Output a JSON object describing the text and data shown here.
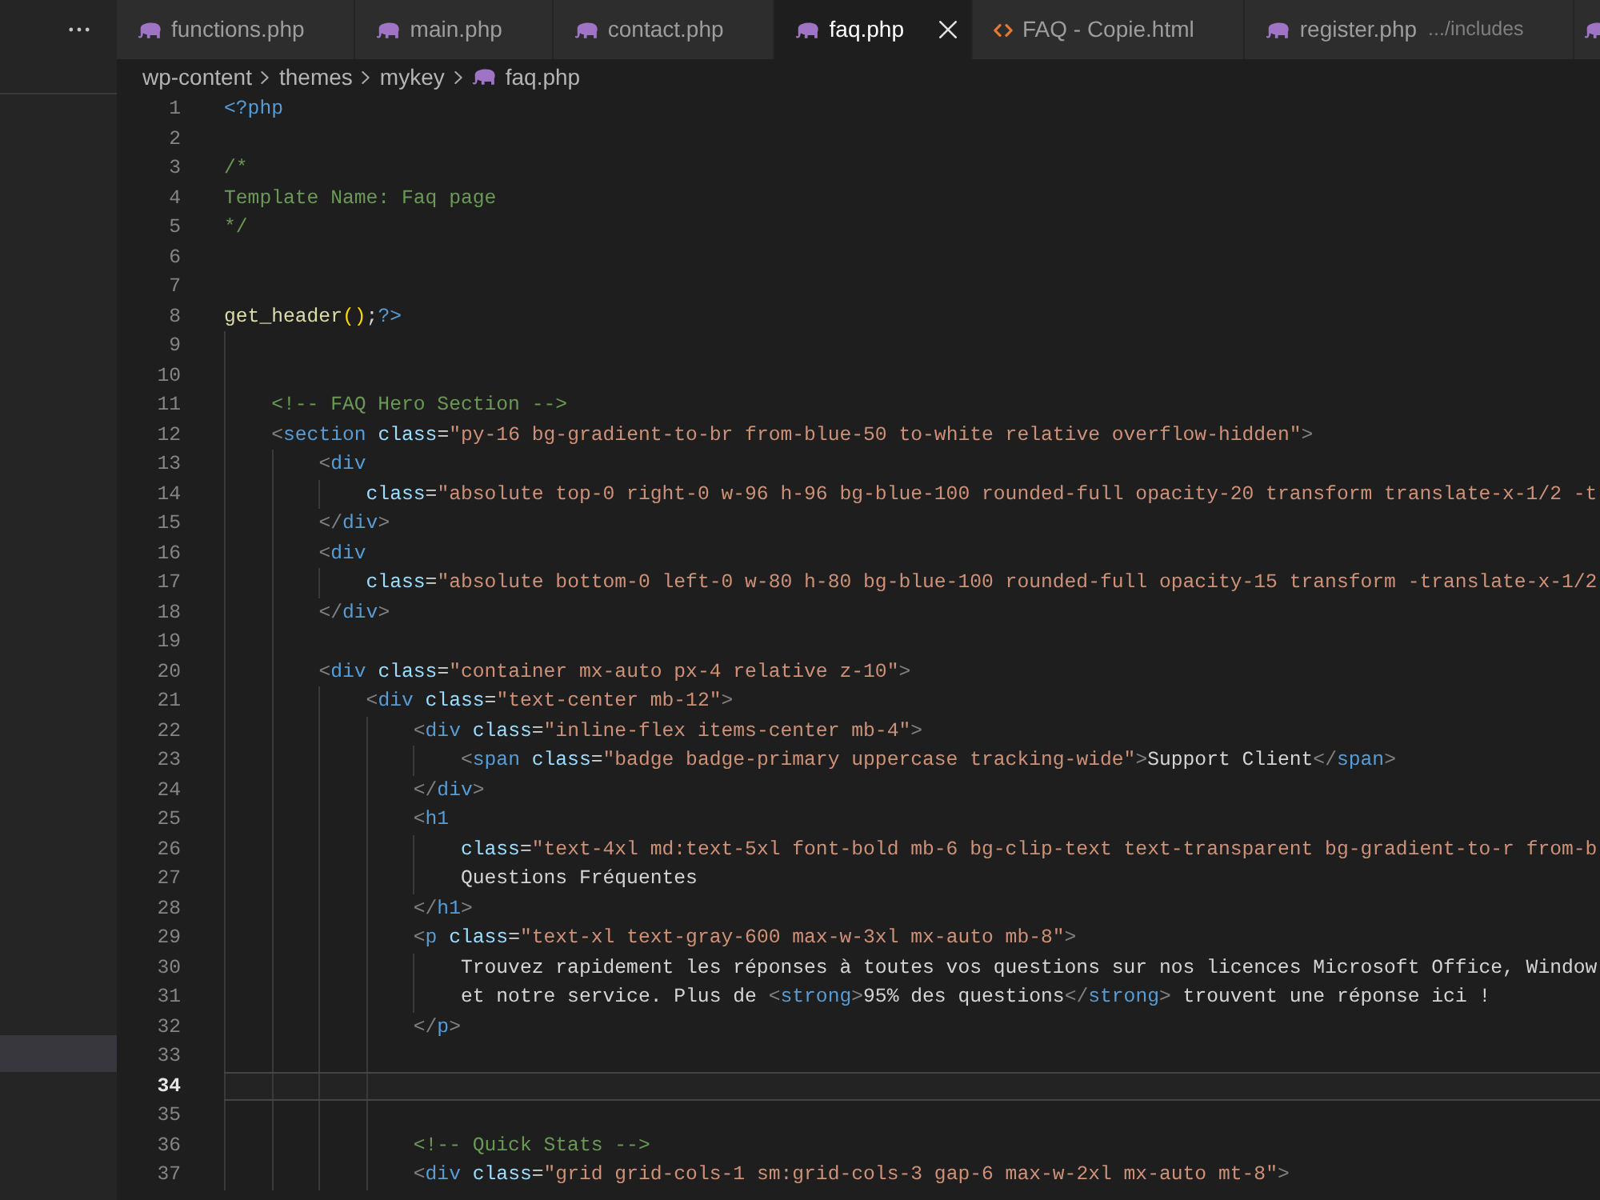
{
  "sidebar": {
    "rows": [
      {
        "selected": true
      }
    ]
  },
  "tabs": [
    {
      "kind": "php",
      "label": "functions.php",
      "selected": false
    },
    {
      "kind": "php",
      "label": "main.php",
      "selected": false
    },
    {
      "kind": "php",
      "label": "contact.php",
      "selected": false
    },
    {
      "kind": "php",
      "label": "faq.php",
      "selected": true
    },
    {
      "kind": "html",
      "label": "FAQ - Copie.html",
      "selected": false
    },
    {
      "kind": "php",
      "label": "register.php",
      "description": ".../includes",
      "selected": false
    },
    {
      "kind": "php",
      "selected": false
    }
  ],
  "breadcrumb": [
    {
      "label": "wp-content"
    },
    {
      "label": "themes"
    },
    {
      "label": "mykey"
    },
    {
      "kind": "php",
      "label": "faq.php"
    }
  ],
  "editor": {
    "lines": [
      {
        "number": "1",
        "current": false,
        "tokens": [
          {
            "kind": "keyword",
            "text": "<?php"
          }
        ]
      },
      {
        "number": "2",
        "current": false
      },
      {
        "number": "3",
        "current": false,
        "tokens": [
          {
            "kind": "comment",
            "text": "/*"
          }
        ]
      },
      {
        "number": "4",
        "current": false,
        "tokens": [
          {
            "kind": "comment",
            "text": "Template Name: Faq page"
          }
        ]
      },
      {
        "number": "5",
        "current": false,
        "tokens": [
          {
            "kind": "comment",
            "text": "*/"
          }
        ]
      },
      {
        "number": "6",
        "current": false
      },
      {
        "number": "7",
        "current": false
      },
      {
        "number": "8",
        "current": false,
        "tokens": [
          {
            "kind": "func",
            "text": "get_header"
          },
          {
            "kind": "bracket",
            "text": "()"
          },
          {
            "kind": "text",
            "text": ";"
          },
          {
            "kind": "keyword",
            "text": "?>"
          }
        ],
        "children": [
          {
            "number": "9",
            "current": false
          },
          {
            "number": "10",
            "current": false
          },
          {
            "number": "11",
            "current": false,
            "tokens": [
              {
                "kind": "comment",
                "text": "<!-- FAQ Hero Section -->"
              }
            ]
          },
          {
            "number": "12",
            "current": false,
            "tokens": [
              {
                "kind": "punct",
                "text": "<"
              },
              {
                "kind": "tag",
                "text": "section"
              },
              {
                "kind": "attr",
                "text": " class"
              },
              {
                "kind": "op",
                "text": "="
              },
              {
                "kind": "string",
                "text": "\"py-16 bg-gradient-to-br from-blue-50 to-white relative overflow-hidden\""
              },
              {
                "kind": "punct",
                "text": ">"
              }
            ],
            "children": [
              {
                "number": "13",
                "current": false,
                "tokens": [
                  {
                    "kind": "punct",
                    "text": "<"
                  },
                  {
                    "kind": "tag",
                    "text": "div"
                  }
                ],
                "children": [
                  {
                    "number": "14",
                    "current": false,
                    "tokens": [
                      {
                        "kind": "attr",
                        "text": "class"
                      },
                      {
                        "kind": "op",
                        "text": "="
                      },
                      {
                        "kind": "string",
                        "text": "\"absolute top-0 right-0 w-96 h-96 bg-blue-100 rounded-full opacity-20 transform translate-x-1/2 -t"
                      }
                    ]
                  }
                ]
              },
              {
                "number": "15",
                "current": false,
                "tokens": [
                  {
                    "kind": "punct",
                    "text": "</"
                  },
                  {
                    "kind": "tag",
                    "text": "div"
                  },
                  {
                    "kind": "punct",
                    "text": ">"
                  }
                ]
              },
              {
                "number": "16",
                "current": false,
                "tokens": [
                  {
                    "kind": "punct",
                    "text": "<"
                  },
                  {
                    "kind": "tag",
                    "text": "div"
                  }
                ],
                "children": [
                  {
                    "number": "17",
                    "current": false,
                    "tokens": [
                      {
                        "kind": "attr",
                        "text": "class"
                      },
                      {
                        "kind": "op",
                        "text": "="
                      },
                      {
                        "kind": "string",
                        "text": "\"absolute bottom-0 left-0 w-80 h-80 bg-blue-100 rounded-full opacity-15 transform -translate-x-1/2"
                      }
                    ]
                  }
                ]
              },
              {
                "number": "18",
                "current": false,
                "tokens": [
                  {
                    "kind": "punct",
                    "text": "</"
                  },
                  {
                    "kind": "tag",
                    "text": "div"
                  },
                  {
                    "kind": "punct",
                    "text": ">"
                  }
                ]
              },
              {
                "number": "19",
                "current": false
              },
              {
                "number": "20",
                "current": false,
                "tokens": [
                  {
                    "kind": "punct",
                    "text": "<"
                  },
                  {
                    "kind": "tag",
                    "text": "div"
                  },
                  {
                    "kind": "attr",
                    "text": " class"
                  },
                  {
                    "kind": "op",
                    "text": "="
                  },
                  {
                    "kind": "string",
                    "text": "\"container mx-auto px-4 relative z-10\""
                  },
                  {
                    "kind": "punct",
                    "text": ">"
                  }
                ],
                "children": [
                  {
                    "number": "21",
                    "current": false,
                    "tokens": [
                      {
                        "kind": "punct",
                        "text": "<"
                      },
                      {
                        "kind": "tag",
                        "text": "div"
                      },
                      {
                        "kind": "attr",
                        "text": " class"
                      },
                      {
                        "kind": "op",
                        "text": "="
                      },
                      {
                        "kind": "string",
                        "text": "\"text-center mb-12\""
                      },
                      {
                        "kind": "punct",
                        "text": ">"
                      }
                    ],
                    "children": [
                      {
                        "number": "22",
                        "current": false,
                        "tokens": [
                          {
                            "kind": "punct",
                            "text": "<"
                          },
                          {
                            "kind": "tag",
                            "text": "div"
                          },
                          {
                            "kind": "attr",
                            "text": " class"
                          },
                          {
                            "kind": "op",
                            "text": "="
                          },
                          {
                            "kind": "string",
                            "text": "\"inline-flex items-center mb-4\""
                          },
                          {
                            "kind": "punct",
                            "text": ">"
                          }
                        ],
                        "children": [
                          {
                            "number": "23",
                            "current": false,
                            "tokens": [
                              {
                                "kind": "punct",
                                "text": "<"
                              },
                              {
                                "kind": "tag",
                                "text": "span"
                              },
                              {
                                "kind": "attr",
                                "text": " class"
                              },
                              {
                                "kind": "op",
                                "text": "="
                              },
                              {
                                "kind": "string",
                                "text": "\"badge badge-primary uppercase tracking-wide\""
                              },
                              {
                                "kind": "punct",
                                "text": ">"
                              },
                              {
                                "kind": "text",
                                "text": "Support Client"
                              },
                              {
                                "kind": "punct",
                                "text": "</"
                              },
                              {
                                "kind": "tag",
                                "text": "span"
                              },
                              {
                                "kind": "punct",
                                "text": ">"
                              }
                            ]
                          }
                        ]
                      },
                      {
                        "number": "24",
                        "current": false,
                        "tokens": [
                          {
                            "kind": "punct",
                            "text": "</"
                          },
                          {
                            "kind": "tag",
                            "text": "div"
                          },
                          {
                            "kind": "punct",
                            "text": ">"
                          }
                        ]
                      },
                      {
                        "number": "25",
                        "current": false,
                        "tokens": [
                          {
                            "kind": "punct",
                            "text": "<"
                          },
                          {
                            "kind": "tag",
                            "text": "h1"
                          }
                        ],
                        "children": [
                          {
                            "number": "26",
                            "current": false,
                            "tokens": [
                              {
                                "kind": "attr",
                                "text": "class"
                              },
                              {
                                "kind": "op",
                                "text": "="
                              },
                              {
                                "kind": "string",
                                "text": "\"text-4xl md:text-5xl font-bold mb-6 bg-clip-text text-transparent bg-gradient-to-r from-b"
                              }
                            ]
                          },
                          {
                            "number": "27",
                            "current": false,
                            "tokens": [
                              {
                                "kind": "text",
                                "text": "Questions Fréquentes"
                              }
                            ]
                          }
                        ]
                      },
                      {
                        "number": "28",
                        "current": false,
                        "tokens": [
                          {
                            "kind": "punct",
                            "text": "</"
                          },
                          {
                            "kind": "tag",
                            "text": "h1"
                          },
                          {
                            "kind": "punct",
                            "text": ">"
                          }
                        ]
                      },
                      {
                        "number": "29",
                        "current": false,
                        "tokens": [
                          {
                            "kind": "punct",
                            "text": "<"
                          },
                          {
                            "kind": "tag",
                            "text": "p"
                          },
                          {
                            "kind": "attr",
                            "text": " class"
                          },
                          {
                            "kind": "op",
                            "text": "="
                          },
                          {
                            "kind": "string",
                            "text": "\"text-xl text-gray-600 max-w-3xl mx-auto mb-8\""
                          },
                          {
                            "kind": "punct",
                            "text": ">"
                          }
                        ],
                        "children": [
                          {
                            "number": "30",
                            "current": false,
                            "tokens": [
                              {
                                "kind": "text",
                                "text": "Trouvez rapidement les réponses à toutes vos questions sur nos licences Microsoft Office, Window"
                              }
                            ]
                          },
                          {
                            "number": "31",
                            "current": false,
                            "tokens": [
                              {
                                "kind": "text",
                                "text": "et notre service. Plus de "
                              },
                              {
                                "kind": "punct",
                                "text": "<"
                              },
                              {
                                "kind": "tag",
                                "text": "strong"
                              },
                              {
                                "kind": "punct",
                                "text": ">"
                              },
                              {
                                "kind": "text",
                                "text": "95% des questions"
                              },
                              {
                                "kind": "punct",
                                "text": "</"
                              },
                              {
                                "kind": "tag",
                                "text": "strong"
                              },
                              {
                                "kind": "punct",
                                "text": ">"
                              },
                              {
                                "kind": "text",
                                "text": " trouvent une réponse ici !"
                              }
                            ]
                          }
                        ]
                      },
                      {
                        "number": "32",
                        "current": false,
                        "tokens": [
                          {
                            "kind": "punct",
                            "text": "</"
                          },
                          {
                            "kind": "tag",
                            "text": "p"
                          },
                          {
                            "kind": "punct",
                            "text": ">"
                          }
                        ]
                      },
                      {
                        "number": "33",
                        "current": false
                      },
                      {
                        "number": "34",
                        "current": true
                      },
                      {
                        "number": "35",
                        "current": false
                      },
                      {
                        "number": "36",
                        "current": false,
                        "tokens": [
                          {
                            "kind": "comment",
                            "text": "<!-- Quick Stats -->"
                          }
                        ]
                      },
                      {
                        "number": "37",
                        "current": false,
                        "tokens": [
                          {
                            "kind": "punct",
                            "text": "<"
                          },
                          {
                            "kind": "tag",
                            "text": "div"
                          },
                          {
                            "kind": "attr",
                            "text": " class"
                          },
                          {
                            "kind": "op",
                            "text": "="
                          },
                          {
                            "kind": "string",
                            "text": "\"grid grid-cols-1 sm:grid-cols-3 gap-6 max-w-2xl mx-auto mt-8\""
                          },
                          {
                            "kind": "punct",
                            "text": ">"
                          }
                        ]
                      }
                    ]
                  }
                ]
              }
            ]
          }
        ]
      }
    ]
  }
}
